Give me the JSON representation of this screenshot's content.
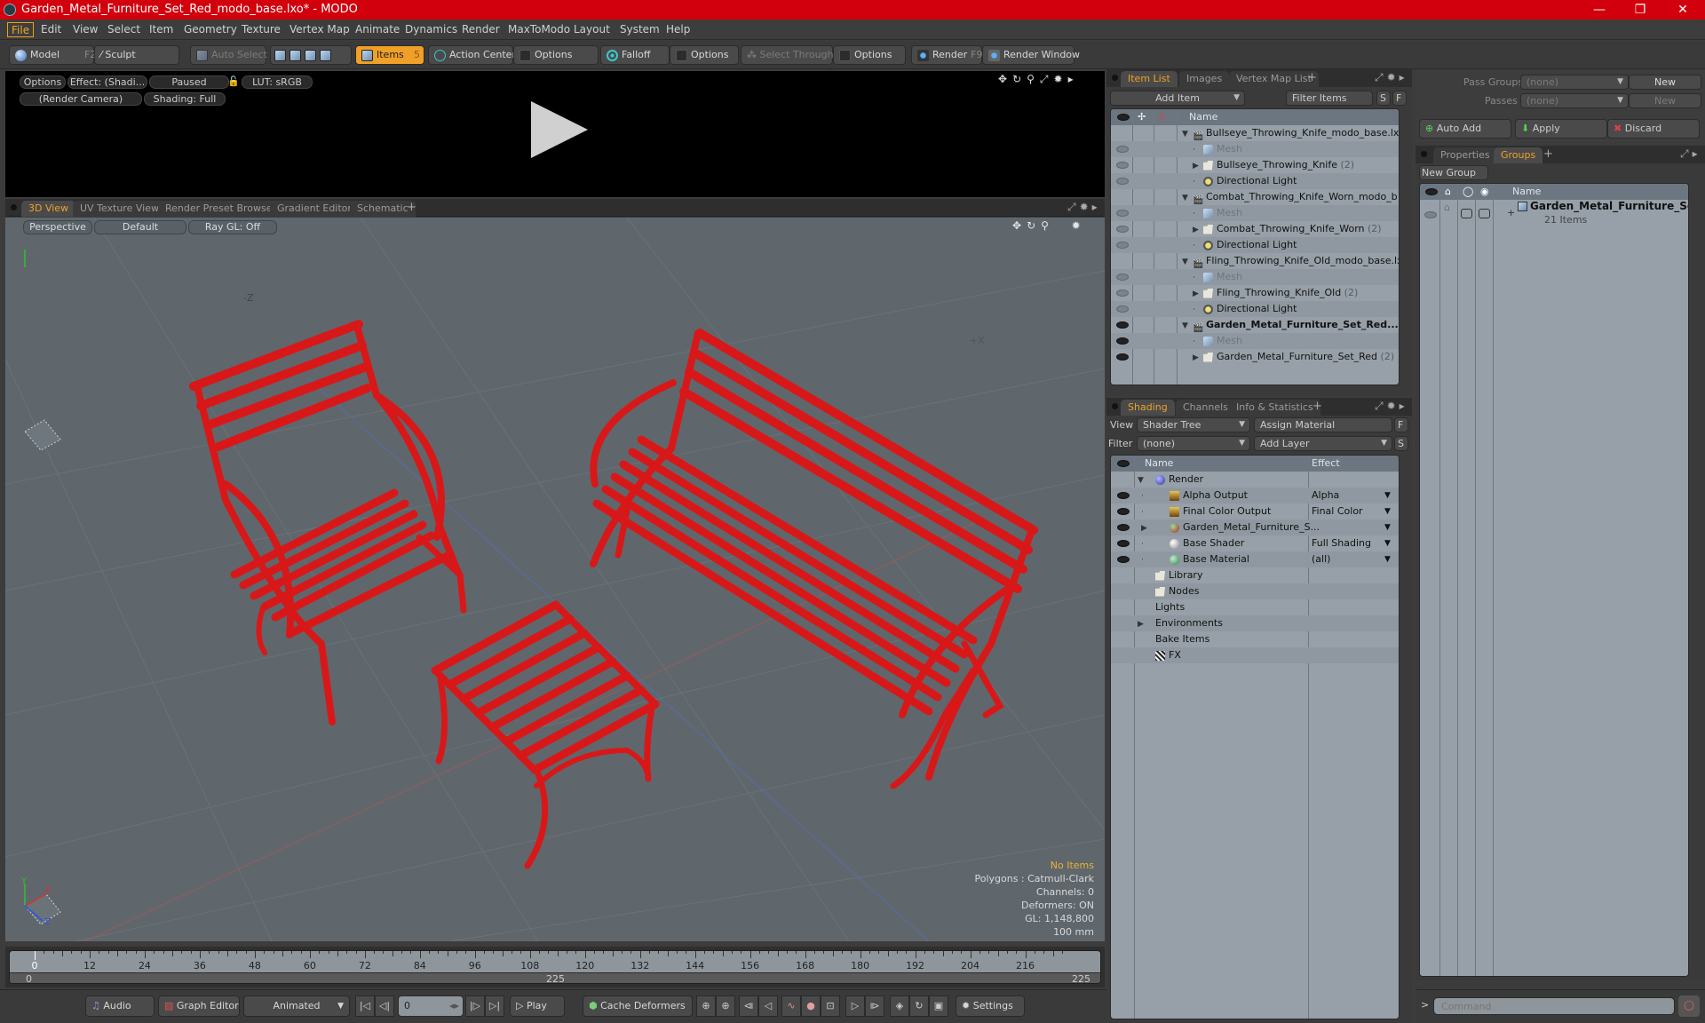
{
  "window": {
    "title": "Garden_Metal_Furniture_Set_Red_modo_base.lxo* - MODO",
    "minimize": "—",
    "maximize": "❐",
    "close": "✕"
  },
  "menu": [
    "File",
    "Edit",
    "View",
    "Select",
    "Item",
    "Geometry",
    "Texture",
    "Vertex Map",
    "Animate",
    "Dynamics",
    "Render",
    "MaxToModo",
    "Layout",
    "System",
    "Help"
  ],
  "toolbar": {
    "model": "Model",
    "model_key": "F2",
    "sculpt": "Sculpt",
    "auto_select": "Auto Select",
    "items": "Items",
    "items_count": "5",
    "action_center": "Action Center",
    "options1": "Options",
    "falloff": "Falloff",
    "options2": "Options",
    "select_through": "Select Through",
    "options3": "Options",
    "render": "Render",
    "render_key": "F9",
    "render_window": "Render Window"
  },
  "preview": {
    "options": "Options",
    "effect": "Effect: (Shadi...",
    "paused": "Paused",
    "lut": "LUT: sRGB",
    "camera": "(Render Camera)",
    "shading": "Shading: Full"
  },
  "viewport_tabs": [
    "3D View",
    "UV Texture View",
    "Render Preset Browser",
    "Gradient Editor",
    "Schematic"
  ],
  "viewport": {
    "perspective": "Perspective",
    "default": "Default",
    "raygl": "Ray GL: Off",
    "axis_neg_z": "-Z",
    "axis_pos_x": "+X",
    "gizmo": {
      "x": "X",
      "y": "Y",
      "z": "Z"
    },
    "stats": [
      "No Items",
      "Polygons : Catmull-Clark",
      "Channels: 0",
      "Deformers: ON",
      "GL: 1,148,800",
      "100 mm"
    ],
    "object_color": "#d81818"
  },
  "timeline": {
    "ticks": [
      "0",
      "12",
      "24",
      "36",
      "48",
      "60",
      "72",
      "84",
      "96",
      "108",
      "120",
      "132",
      "144",
      "156",
      "168",
      "180",
      "192",
      "204",
      "216"
    ],
    "range_start": "0",
    "range_end": "225",
    "range_end2": "225",
    "current": "0",
    "max": 225
  },
  "bottombar": {
    "audio": "Audio",
    "graph_editor": "Graph Editor",
    "animated": "Animated",
    "frame": "0",
    "play": "Play",
    "cache_deformers": "Cache Deformers",
    "settings": "Settings"
  },
  "item_list": {
    "tabs": [
      "Item List",
      "Images",
      "Vertex Map List"
    ],
    "add_item": "Add Item",
    "filter_items": "Filter Items",
    "s": "S",
    "f": "F",
    "col_name": "Name",
    "rows": [
      {
        "label": "Bullseye_Throwing_Knife_modo_base.lxo",
        "type": "scene",
        "level": 0,
        "eye": ""
      },
      {
        "label": "Mesh",
        "type": "mesh",
        "level": 1,
        "eye": "dim"
      },
      {
        "label": "Bullseye_Throwing_Knife",
        "count": "(2)",
        "type": "group",
        "level": 1,
        "eye": "dim"
      },
      {
        "label": "Directional Light",
        "type": "light",
        "level": 1,
        "eye": "dim"
      },
      {
        "label": "Combat_Throwing_Knife_Worn_modo_b ...",
        "type": "scene",
        "level": 0,
        "eye": ""
      },
      {
        "label": "Mesh",
        "type": "mesh",
        "level": 1,
        "eye": "dim"
      },
      {
        "label": "Combat_Throwing_Knife_Worn",
        "count": "(2)",
        "type": "group",
        "level": 1,
        "eye": "dim"
      },
      {
        "label": "Directional Light",
        "type": "light",
        "level": 1,
        "eye": "dim"
      },
      {
        "label": "Fling_Throwing_Knife_Old_modo_base.lxo",
        "type": "scene",
        "level": 0,
        "eye": ""
      },
      {
        "label": "Mesh",
        "type": "mesh",
        "level": 1,
        "eye": "dim"
      },
      {
        "label": "Fling_Throwing_Knife_Old",
        "count": "(2)",
        "type": "group",
        "level": 1,
        "eye": "dim"
      },
      {
        "label": "Directional Light",
        "type": "light",
        "level": 1,
        "eye": "dim"
      },
      {
        "label": "Garden_Metal_Furniture_Set_Red...",
        "type": "scene",
        "level": 0,
        "eye": "dark",
        "bold": true
      },
      {
        "label": "Mesh",
        "type": "mesh",
        "level": 1,
        "eye": "dark"
      },
      {
        "label": "Garden_Metal_Furniture_Set_Red",
        "count": "(2)",
        "type": "group",
        "level": 1,
        "eye": "dark"
      }
    ]
  },
  "shading": {
    "tabs": [
      "Shading",
      "Channels",
      "Info & Statistics"
    ],
    "view_label": "View",
    "view_value": "Shader Tree",
    "assign_material": "Assign Material",
    "filter_label": "Filter",
    "filter_value": "(none)",
    "add_layer": "Add Layer",
    "f": "F",
    "s": "S",
    "col_name": "Name",
    "col_effect": "Effect",
    "rows": [
      {
        "label": "Render",
        "effect": "",
        "icon": "render",
        "level": 0,
        "eye": false,
        "dd": false
      },
      {
        "label": "Alpha Output",
        "effect": "Alpha",
        "icon": "output",
        "level": 1,
        "eye": true,
        "dd": true
      },
      {
        "label": "Final Color Output",
        "effect": "Final Color",
        "icon": "output",
        "level": 1,
        "eye": true,
        "dd": true
      },
      {
        "label": "Garden_Metal_Furniture_S...",
        "effect": "",
        "icon": "material-group",
        "level": 1,
        "eye": true,
        "dd": true
      },
      {
        "label": "Base Shader",
        "effect": "Full Shading",
        "icon": "shader",
        "level": 1,
        "eye": true,
        "dd": true
      },
      {
        "label": "Base Material",
        "effect": "(all)",
        "icon": "material",
        "level": 1,
        "eye": true,
        "dd": true
      },
      {
        "label": "Library",
        "effect": "",
        "icon": "folder",
        "level": 0,
        "eye": false,
        "dd": false
      },
      {
        "label": "Nodes",
        "effect": "",
        "icon": "folder",
        "level": 0,
        "eye": false,
        "dd": false
      },
      {
        "label": "Lights",
        "effect": "",
        "icon": "none",
        "level": 0,
        "eye": false,
        "dd": false
      },
      {
        "label": "Environments",
        "effect": "",
        "icon": "none",
        "level": 0,
        "eye": false,
        "dd": false
      },
      {
        "label": "Bake Items",
        "effect": "",
        "icon": "none",
        "level": 0,
        "eye": false,
        "dd": false
      },
      {
        "label": "FX",
        "effect": "",
        "icon": "clapper",
        "level": 0,
        "eye": false,
        "dd": false
      }
    ]
  },
  "passes": {
    "pass_groups_label": "Pass Groups",
    "pass_groups_value": "(none)",
    "passes_label": "Passes",
    "passes_value": "(none)",
    "new1": "New",
    "new2": "New",
    "auto_add": "Auto Add",
    "apply": "Apply",
    "discard": "Discard"
  },
  "groups": {
    "tabs": [
      "Properties",
      "Groups"
    ],
    "new_group": "New Group",
    "col_name": "Name",
    "group_name": "Garden_Metal_Furniture_Set...",
    "group_count": "21 Items"
  },
  "command": {
    "prompt": ">",
    "placeholder": "Command"
  }
}
